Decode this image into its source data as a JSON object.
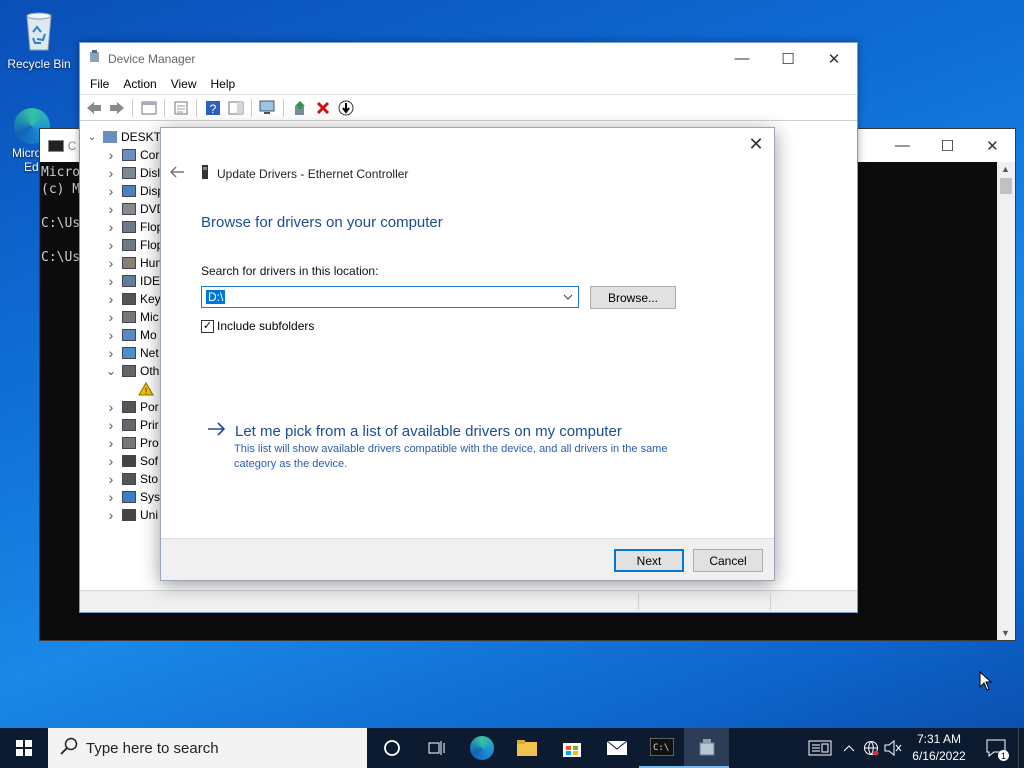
{
  "desktop": {
    "recycle_bin_label": "Recycle Bin",
    "edge_label_line1": "Micro",
    "edge_label_line2": "Ed"
  },
  "console": {
    "title": "C",
    "lines": [
      "Micro",
      "(c) M",
      "",
      "C:\\Us",
      "",
      "C:\\Us"
    ]
  },
  "device_manager": {
    "title": "Device Manager",
    "menu": [
      "File",
      "Action",
      "View",
      "Help"
    ],
    "root": "DESKTO",
    "tree_items": [
      "Cor",
      "Disl",
      "Disp",
      "DVD",
      "Flop",
      "Flop",
      "Hun",
      "IDE",
      "Key",
      "Mic",
      "Mo",
      "Net",
      "Oth",
      "",
      "Por",
      "Prir",
      "Pro",
      "Sof",
      "Sto",
      "Syst",
      "Uni"
    ]
  },
  "dialog": {
    "header": "Update Drivers - Ethernet Controller",
    "heading": "Browse for drivers on your computer",
    "search_label": "Search for drivers in this location:",
    "path_value": "D:\\",
    "browse_label": "Browse...",
    "include_subfolders_label": "Include subfolders",
    "include_subfolders_checked": true,
    "pick_title": "Let me pick from a list of available drivers on my computer",
    "pick_description": "This list will show available drivers compatible with the device, and all drivers in the same category as the device.",
    "next_label": "Next",
    "cancel_label": "Cancel"
  },
  "taskbar": {
    "search_placeholder": "Type here to search",
    "time": "7:31 AM",
    "date": "6/16/2022",
    "notification_count": "1"
  }
}
